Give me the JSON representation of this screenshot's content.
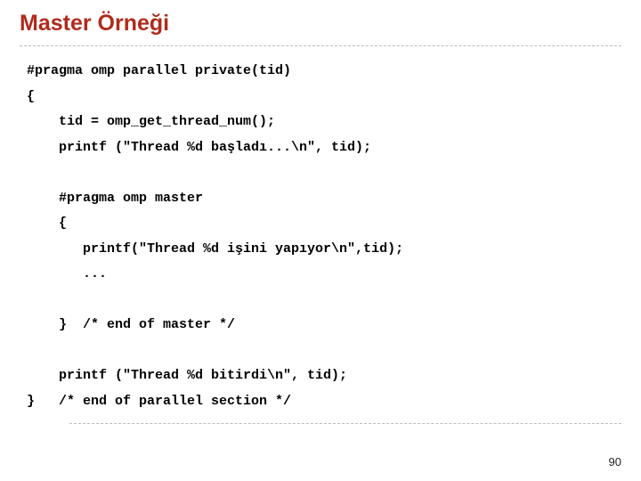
{
  "title": "Master Örneği",
  "code": "#pragma omp parallel private(tid) \n{\n    tid = omp_get_thread_num();\n    printf (\"Thread %d başladı...\\n\", tid);\n\n    #pragma omp master\n    {\n       printf(\"Thread %d işini yapıyor\\n\",tid);\n       ...\n\n    }  /* end of master */\n\n    printf (\"Thread %d bitirdi\\n\", tid);\n}   /* end of parallel section */",
  "pageNumber": "90"
}
